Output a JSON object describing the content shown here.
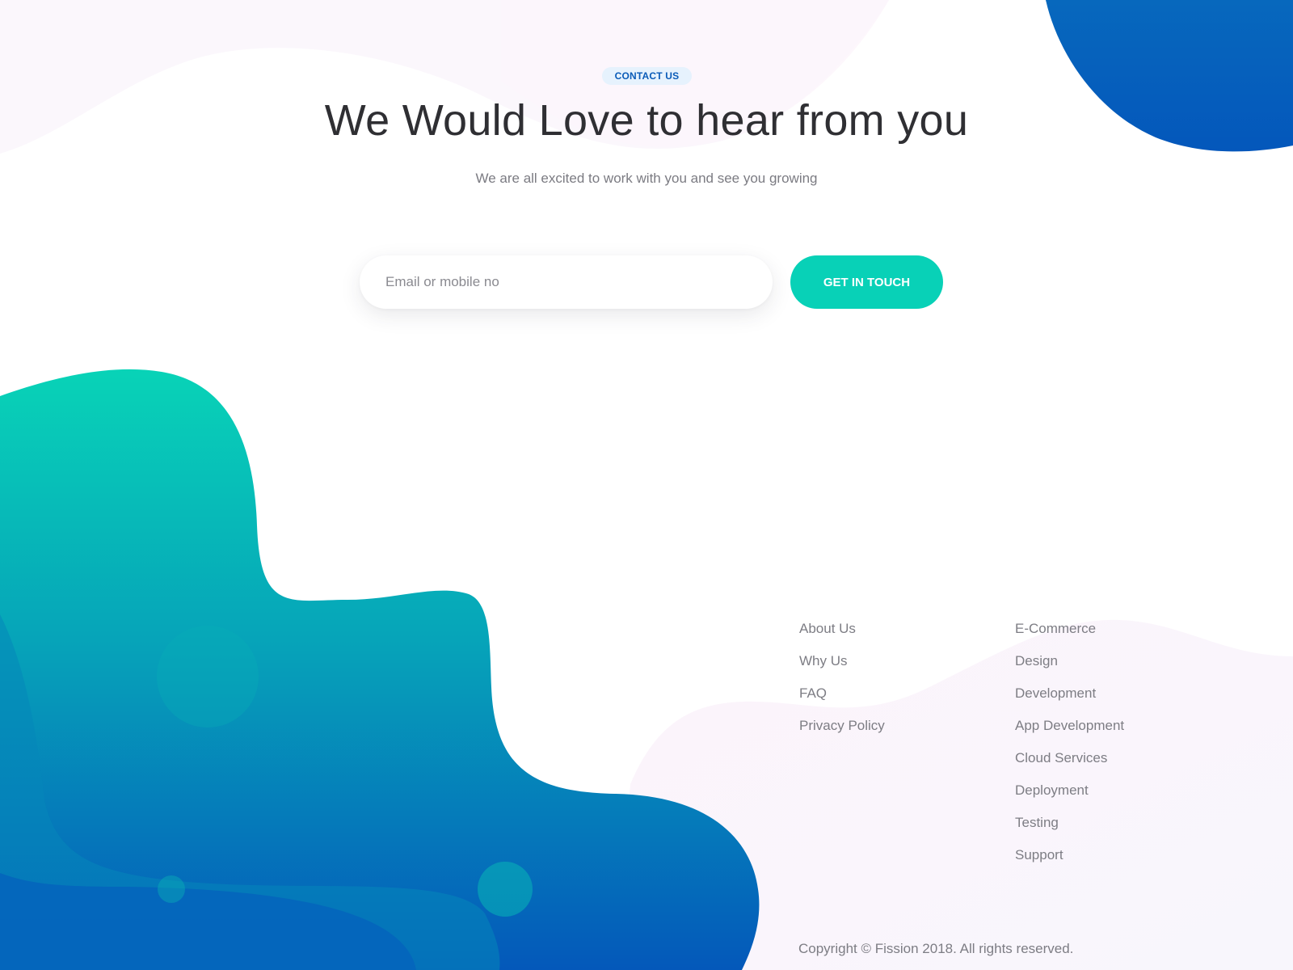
{
  "hero": {
    "badge": "CONTACT US",
    "title": "We Would Love to hear from you",
    "subtitle": "We are all excited to work with you and see you growing"
  },
  "form": {
    "input_placeholder": "Email or mobile no",
    "input_value": "",
    "submit_label": "GET IN TOUCH"
  },
  "footer": {
    "company_links": [
      {
        "label": "About Us"
      },
      {
        "label": "Why Us"
      },
      {
        "label": "FAQ"
      },
      {
        "label": "Privacy Policy"
      }
    ],
    "service_links": [
      {
        "label": "E-Commerce"
      },
      {
        "label": "Design"
      },
      {
        "label": "Development"
      },
      {
        "label": "App Development"
      },
      {
        "label": "Cloud Services"
      },
      {
        "label": "Deployment"
      },
      {
        "label": "Testing"
      },
      {
        "label": "Support"
      }
    ],
    "copyright": "Copyright © Fission 2018. All rights reserved."
  },
  "colors": {
    "accent_teal": "#08d1b7",
    "brand_blue": "#0558b8",
    "badge_text": "#0a5bb8",
    "badge_bg": "#e6f2fd",
    "text_dark": "#2f2f33",
    "text_muted": "#7d7d84",
    "blob_pink": "#fbf3fb"
  }
}
